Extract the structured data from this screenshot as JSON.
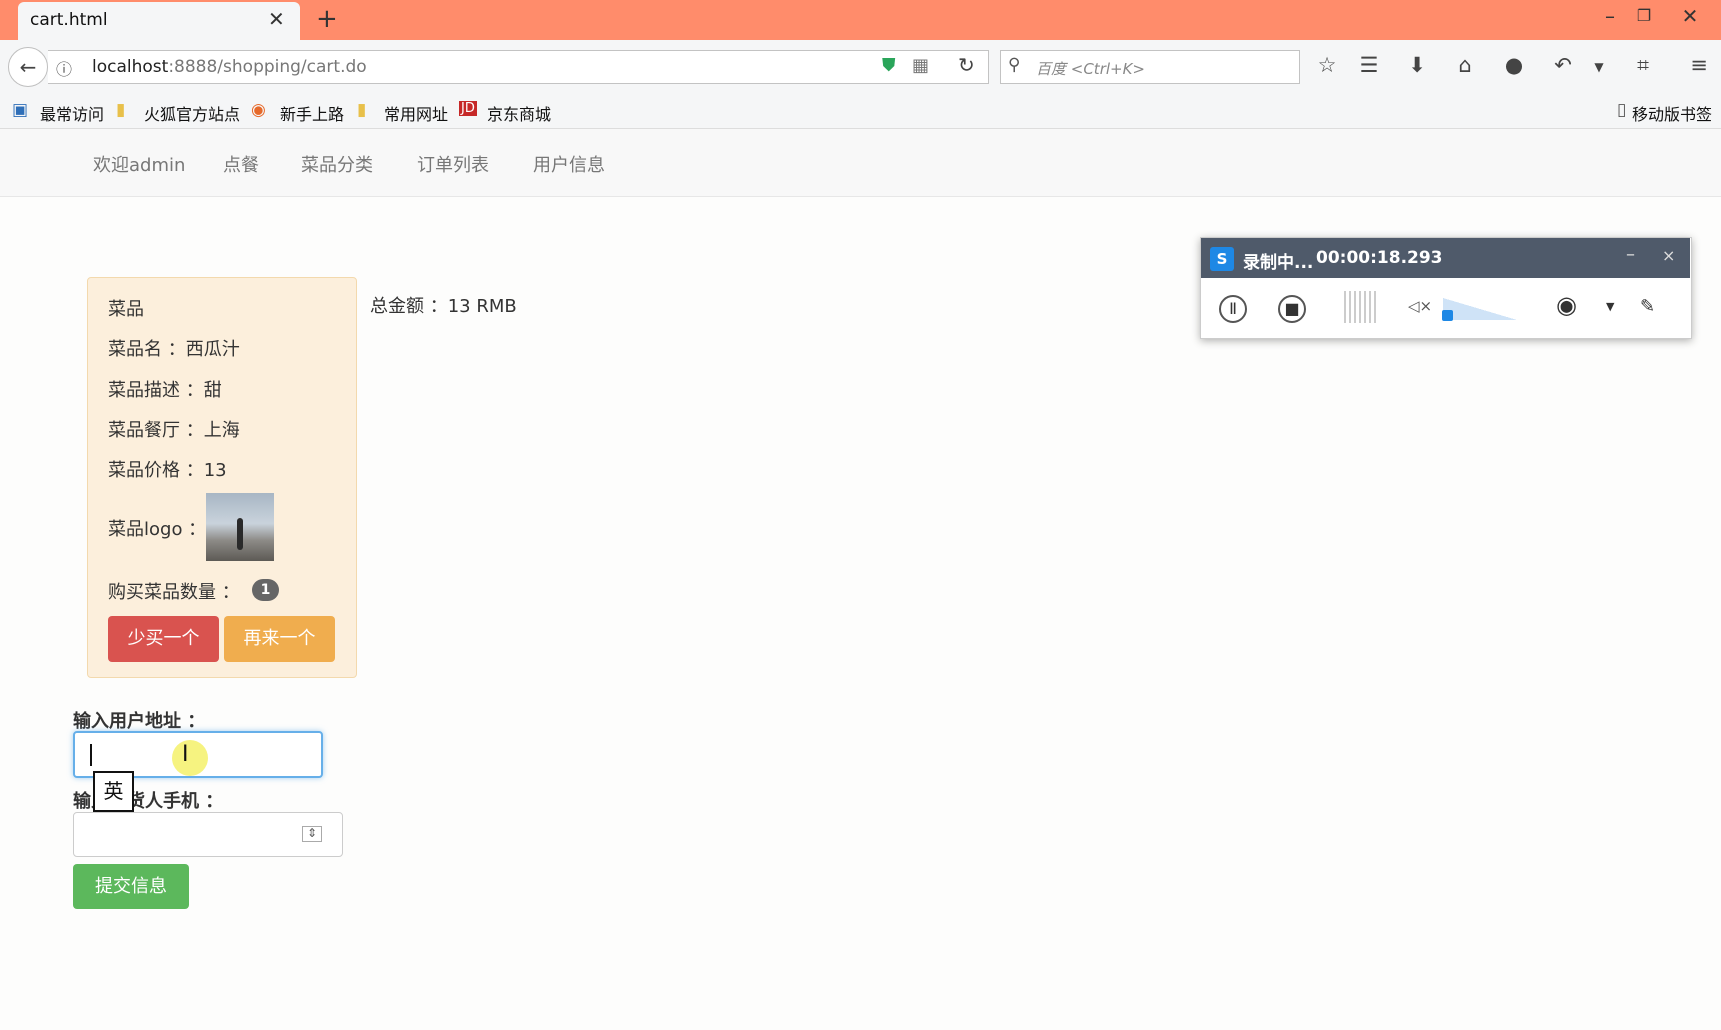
{
  "browser": {
    "tab_title": "cart.html",
    "tab_close": "✕",
    "new_tab": "+",
    "window_controls": [
      "–",
      "❐",
      "✕"
    ],
    "url_host": "localhost",
    "url_rest": ":8888/shopping/cart.do",
    "search_placeholder": "百度 <Ctrl+K>",
    "bookmarks": [
      "最常访问",
      "火狐官方站点",
      "新手上路",
      "常用网址",
      "京东商城"
    ],
    "mobile_bookmarks": "移动版书签"
  },
  "nav": {
    "items": [
      "欢迎admin",
      "点餐",
      "菜品分类",
      "订单列表",
      "用户信息"
    ]
  },
  "dish": {
    "heading": "菜品",
    "name_label": "菜品名 ：西瓜汁",
    "desc_label": "菜品描述 ：甜",
    "restaurant_label": "菜品餐厅 ：上海",
    "price_label": "菜品价格 ：13",
    "logo_label": "菜品logo ：",
    "qty_label": "购买菜品数量 ：",
    "qty_value": "1",
    "less_button": "少买一个",
    "more_button": "再来一个"
  },
  "total": "总金额 ：13 RMB",
  "form": {
    "address_label": "输入用户地址 ：",
    "phone_label": "输入收货人手机 ：",
    "ime_indicator": "英",
    "submit_button": "提交信息"
  },
  "recorder": {
    "status": "录制中...",
    "time": "00:00:18.293",
    "minimize": "–",
    "close": "×"
  }
}
